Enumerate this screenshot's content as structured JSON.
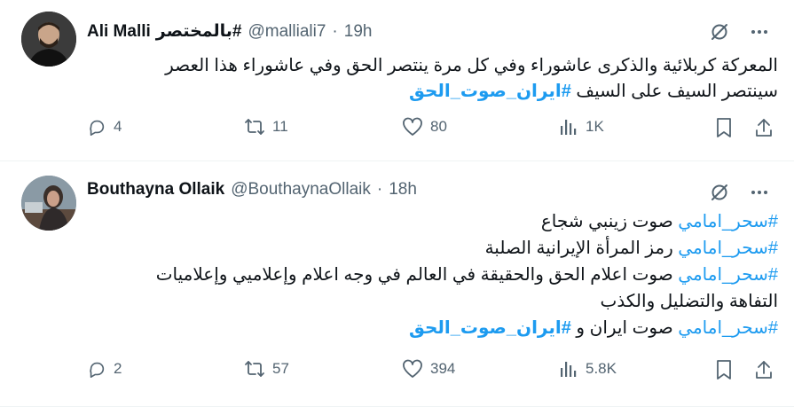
{
  "tweets": [
    {
      "author_name": "Ali Malli",
      "author_name_tag": "#بالمختصر",
      "handle": "@malliali7",
      "separator": "·",
      "time": "19h",
      "lines": [
        [
          {
            "text": "المعركة كربلائية والذكرى عاشوراء وفي كل مرة ينتصر الحق وفي عاشوراء هذا العصر",
            "type": "text"
          }
        ],
        [
          {
            "text": "سينتصر السيف على السيف ",
            "type": "text"
          },
          {
            "text": "#ايران_صوت_الحق",
            "type": "hashtag-bold"
          }
        ]
      ],
      "stats": {
        "replies": "4",
        "retweets": "11",
        "likes": "80",
        "views": "1K"
      }
    },
    {
      "author_name": "Bouthayna Ollaik",
      "handle": "@BouthaynaOllaik",
      "separator": "·",
      "time": "18h",
      "lines": [
        [
          {
            "text": "#سحر_امامي",
            "type": "hashtag"
          },
          {
            "text": " صوت زينبي شجاع",
            "type": "text"
          }
        ],
        [
          {
            "text": "#سحر_امامي",
            "type": "hashtag"
          },
          {
            "text": " رمز المرأة الإيرانية الصلبة",
            "type": "text"
          }
        ],
        [
          {
            "text": "#سحر_امامي",
            "type": "hashtag"
          },
          {
            "text": " صوت اعلام الحق والحقيقة في العالم في وجه اعلام وإعلاميي وإعلاميات",
            "type": "text"
          }
        ],
        [
          {
            "text": "التفاهة والتضليل والكذب",
            "type": "text"
          }
        ],
        [
          {
            "text": "#سحر_امامي",
            "type": "hashtag"
          },
          {
            "text": " صوت ايران و ",
            "type": "text"
          },
          {
            "text": "#ايران_صوت_الحق",
            "type": "hashtag-bold"
          }
        ]
      ],
      "stats": {
        "replies": "2",
        "retweets": "57",
        "likes": "394",
        "views": "5.8K"
      }
    }
  ],
  "icons": {
    "grok": "grok-icon",
    "more": "more-icon",
    "reply": "reply-icon",
    "retweet": "retweet-icon",
    "like": "heart-icon",
    "views": "views-icon",
    "bookmark": "bookmark-icon",
    "share": "share-icon"
  },
  "colors": {
    "text": "#0f1419",
    "secondary": "#536471",
    "hashtag": "#1d9bf0",
    "divider": "#eff3f4"
  }
}
